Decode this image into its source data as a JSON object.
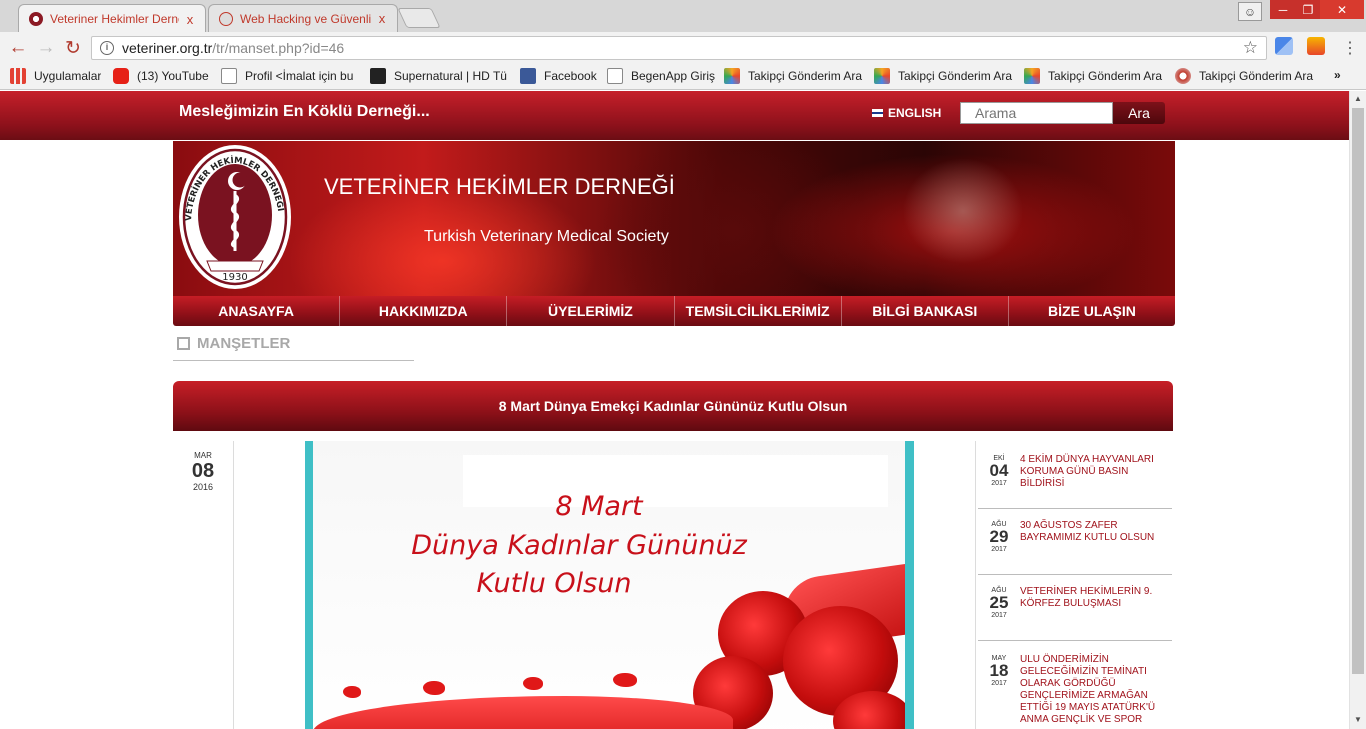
{
  "browser": {
    "tabs": [
      {
        "title": "Veteriner Hekimler Derne",
        "close": "x"
      },
      {
        "title": "Web Hacking ve Güvenli",
        "close": "x"
      }
    ],
    "url_host": "veteriner.org.tr",
    "url_path": "/tr/manset.php?id=46",
    "bookmarks": [
      {
        "label": "Uygulamalar",
        "color": "#e34133"
      },
      {
        "label": "(13) YouTube",
        "color": "#e62117"
      },
      {
        "label": "Profil <İmalat için bu",
        "color": "#ffffff"
      },
      {
        "label": "Supernatural | HD Tü",
        "color": "#222222"
      },
      {
        "label": "Facebook",
        "color": "#3b5998"
      },
      {
        "label": "BegenApp Giriş",
        "color": "#ffffff"
      },
      {
        "label": "Takipçi Gönderim Ara",
        "color": "#f5a623"
      },
      {
        "label": "Takipçi Gönderim Ara",
        "color": "#f5a623"
      },
      {
        "label": "Takipçi Gönderim Ara",
        "color": "#f5a623"
      },
      {
        "label": "Takipçi Gönderim Ara",
        "color": "#e2c0c0"
      }
    ],
    "more_bookmarks": "»"
  },
  "site": {
    "slogan": "Mesleğimizin En Köklü Derneği...",
    "language_link": "ENGLISH",
    "search_placeholder": "Arama",
    "search_button": "Ara",
    "title": "VETERİNER HEKİMLER DERNEĞİ",
    "subtitle": "Turkish Veterinary Medical Society",
    "logo_year": "1930",
    "logo_text": "VETERİNER HEKİMLER DERNEĞİ",
    "nav": [
      "ANASAYFA",
      "HAKKIMIZDA",
      "ÜYELERİMİZ",
      "TEMSİLCİLİKLERİMİZ",
      "BİLGİ BANKASI",
      "BİZE ULAŞIN"
    ]
  },
  "content": {
    "section_title": "MANŞETLER",
    "headline": "8 Mart Dünya Emekçi Kadınlar Gününüz Kutlu Olsun",
    "date": {
      "month": "MAR",
      "day": "08",
      "year": "2016"
    },
    "poster_lines": [
      "8 Mart",
      "Dünya Kadınlar Gününüz",
      "Kutlu Olsun"
    ]
  },
  "sidebar": [
    {
      "month": "EKİ",
      "day": "04",
      "year": "2017",
      "title": "4 EKİM DÜNYA HAYVANLARI KORUMA GÜNÜ BASIN BİLDİRİSİ"
    },
    {
      "month": "AĞU",
      "day": "29",
      "year": "2017",
      "title": "30 AĞUSTOS ZAFER BAYRAMIMIZ KUTLU OLSUN"
    },
    {
      "month": "AĞU",
      "day": "25",
      "year": "2017",
      "title": "VETERİNER HEKİMLERİN 9. KÖRFEZ BULUŞMASI"
    },
    {
      "month": "MAY",
      "day": "18",
      "year": "2017",
      "title": "ULU ÖNDERİMİZİN GELECEĞİMİZİN TEMİNATI OLARAK GÖRDÜĞÜ GENÇLERİMİZE ARMAĞAN ETTİĞİ 19 MAYIS ATATÜRK'Ü ANMA GENÇLİK VE SPOR"
    }
  ]
}
